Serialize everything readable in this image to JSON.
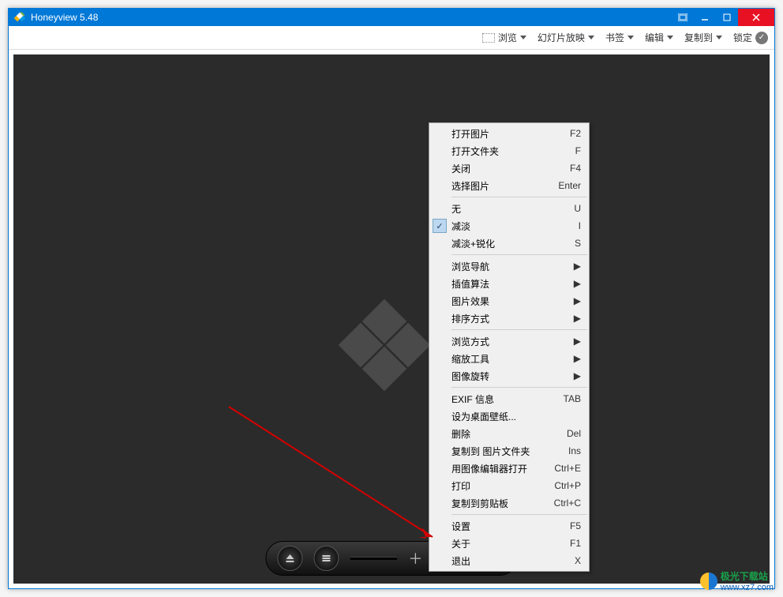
{
  "app": {
    "title": "Honeyview 5.48"
  },
  "toolbar": {
    "browse": "浏览",
    "slideshow": "幻灯片放映",
    "bookmarks": "书签",
    "edit": "编辑",
    "copyto": "复制到",
    "lock": "锁定"
  },
  "contextMenu": {
    "open_image": {
      "label": "打开图片",
      "shortcut": "F2"
    },
    "open_folder": {
      "label": "打开文件夹",
      "shortcut": "F"
    },
    "close": {
      "label": "关闭",
      "shortcut": "F4"
    },
    "select_image": {
      "label": "选择图片",
      "shortcut": "Enter"
    },
    "none": {
      "label": "无",
      "shortcut": "U"
    },
    "fade": {
      "label": "减淡",
      "shortcut": "I"
    },
    "fade_sharpen": {
      "label": "减淡+锐化",
      "shortcut": "S"
    },
    "browse_nav": {
      "label": "浏览导航"
    },
    "interp_algo": {
      "label": "插值算法"
    },
    "img_effects": {
      "label": "图片效果"
    },
    "sort_mode": {
      "label": "排序方式"
    },
    "browse_mode": {
      "label": "浏览方式"
    },
    "zoom_tools": {
      "label": "缩放工具"
    },
    "img_rotate": {
      "label": "图像旋转"
    },
    "exif_info": {
      "label": "EXIF 信息",
      "shortcut": "TAB"
    },
    "set_wallpaper": {
      "label": "设为桌面壁纸..."
    },
    "delete": {
      "label": "删除",
      "shortcut": "Del"
    },
    "copy_to_folder": {
      "label": "复制到 图片文件夹",
      "shortcut": "Ins"
    },
    "open_editor": {
      "label": "用图像编辑器打开",
      "shortcut": "Ctrl+E"
    },
    "print": {
      "label": "打印",
      "shortcut": "Ctrl+P"
    },
    "copy_clipboard": {
      "label": "复制到剪贴板",
      "shortcut": "Ctrl+C"
    },
    "settings": {
      "label": "设置",
      "shortcut": "F5"
    },
    "about": {
      "label": "关于",
      "shortcut": "F1"
    },
    "exit": {
      "label": "退出",
      "shortcut": "X"
    }
  },
  "watermark": {
    "brand": "极光下载站",
    "url": "www.xz7.com"
  }
}
